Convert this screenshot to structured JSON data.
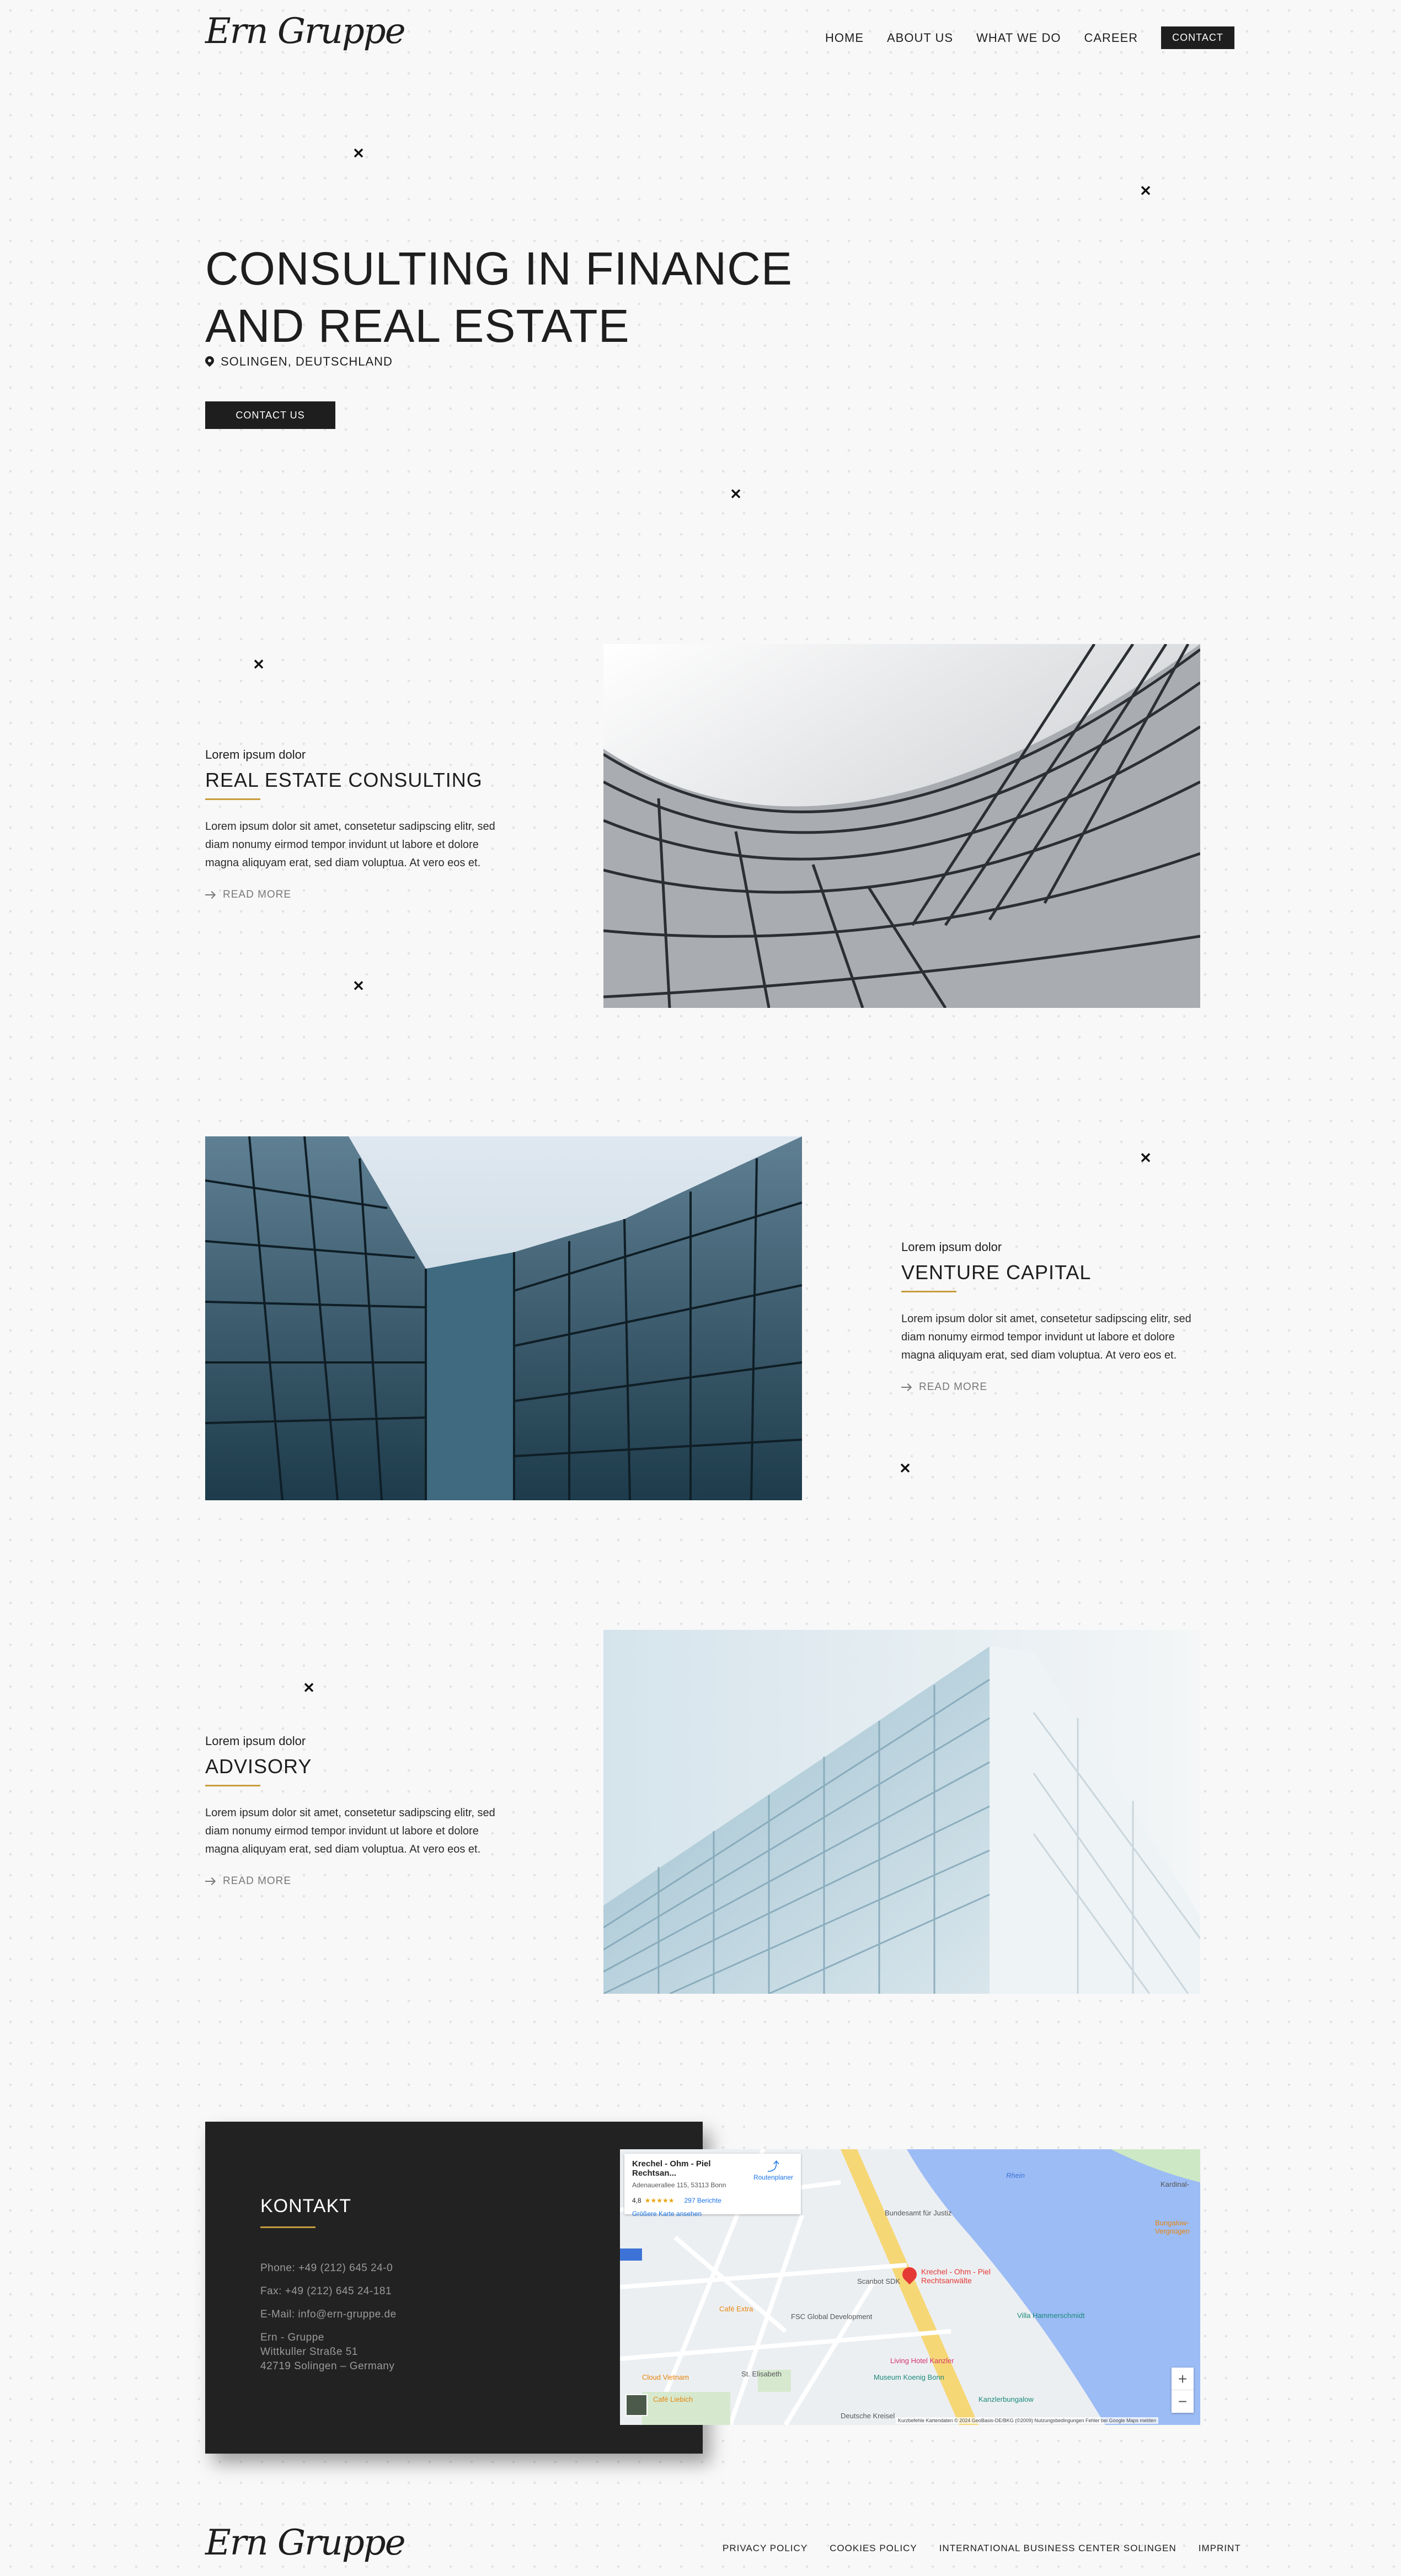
{
  "header": {
    "logo_text": "Ern Gruppe",
    "nav": [
      "HOME",
      "ABOUT US",
      "WHAT WE DO",
      "CAREER"
    ],
    "contact_label": "CONTACT"
  },
  "hero": {
    "title_line1": "CONSULTING IN FINANCE",
    "title_line2": "AND REAL ESTATE",
    "location": "SOLINGEN, DEUTSCHLAND",
    "cta_label": "CONTACT US"
  },
  "services": [
    {
      "eyebrow": "Lorem ipsum dolor",
      "title": "REAL ESTATE CONSULTING",
      "text": "Lorem ipsum dolor sit amet, consetetur sadipscing elitr, sed diam nonumy eirmod tempor invidunt ut labore et dolore magna aliquyam erat, sed diam voluptua. At vero eos et.",
      "read_more": "READ MORE"
    },
    {
      "eyebrow": "Lorem ipsum dolor",
      "title": "VENTURE CAPITAL",
      "text": "Lorem ipsum dolor sit amet, consetetur sadipscing elitr, sed diam nonumy eirmod tempor invidunt ut labore et dolore magna aliquyam erat, sed diam voluptua. At vero eos et.",
      "read_more": "READ MORE"
    },
    {
      "eyebrow": "Lorem ipsum dolor",
      "title": "ADVISORY",
      "text": "Lorem ipsum dolor sit amet, consetetur sadipscing elitr, sed diam nonumy eirmod tempor invidunt ut labore et dolore magna aliquyam erat, sed diam voluptua. At vero eos et.",
      "read_more": "READ MORE"
    }
  ],
  "contact": {
    "title": "KONTAKT",
    "phone": "Phone: +49 (212) 645 24-0",
    "fax": "Fax: +49 (212) 645 24-181",
    "email": "E-Mail: info@ern-gruppe.de",
    "address_line1": "Ern - Gruppe",
    "address_line2": "Wittkuller Straße 51",
    "address_line3": "42719 Solingen – Germany"
  },
  "map": {
    "place_name": "Krechel - Ohm - Piel Rechtsan...",
    "place_address": "Adenauerallee 115, 53113 Bonn",
    "rating": "4,8",
    "stars": "★★★★★",
    "reviews": "297 Berichte",
    "larger_map": "Größere Karte ansehen",
    "route_label": "Routenplaner",
    "pin_label": "Krechel - Ohm - Piel Rechtsanwälte",
    "labels": [
      "Bundesamt für Justiz",
      "Scanbot SDK",
      "FSC Global Development",
      "Villa Hammerschmidt",
      "Living Hotel Kanzler",
      "Museum Koenig Bonn",
      "Kanzlerbungalow",
      "Café Extra",
      "Cloud Vietnam",
      "Café Liebich",
      "St. Elisabeth",
      "Deutsche Kreisel",
      "Rhein",
      "Kardinal-",
      "Bungalow-Vergnügen"
    ],
    "footer_text": "Kurzbefehle  Kartendaten © 2024 GeoBasis-DE/BKG (©2009)  Nutzungsbedingungen  Fehler bei Google Maps melden",
    "zoom_in": "+",
    "zoom_out": "−"
  },
  "footer": {
    "logo_text": "Ern Gruppe",
    "links": [
      "PRIVACY POLICY",
      "COOKIES POLICY",
      "INTERNATIONAL BUSINESS CENTER SOLINGEN",
      "IMPRINT"
    ]
  },
  "colors": {
    "accent": "#c89b3c",
    "dark": "#1e1e1e",
    "background": "#f8f8f8",
    "map_water": "#9cbcf5"
  }
}
